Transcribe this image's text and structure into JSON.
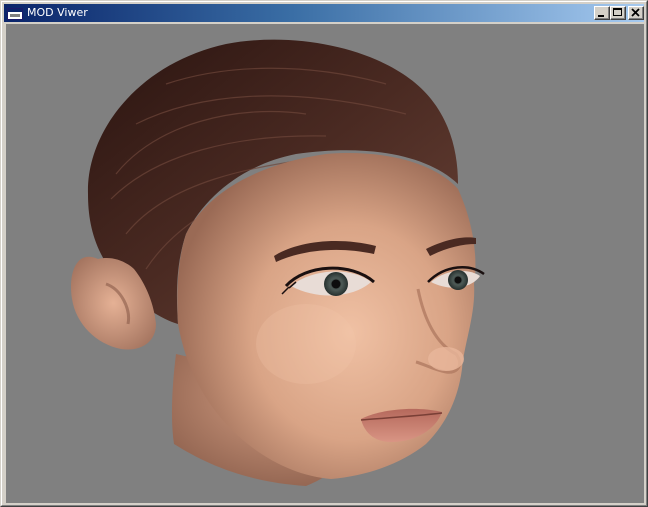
{
  "window": {
    "title": "MOD Viwer",
    "viewport_background": "#808080"
  },
  "titlebar": {
    "app_icon": "app-window-icon",
    "buttons": [
      {
        "name": "minimize",
        "icon": "minimize-icon"
      },
      {
        "name": "maximize",
        "icon": "maximize-icon"
      },
      {
        "name": "close",
        "icon": "close-icon"
      }
    ]
  },
  "viewport": {
    "content": "3d-model-render",
    "model": "human-head",
    "colors": {
      "hair": "#3a1e17",
      "skin": "#d9a486",
      "lips": "#c98472"
    }
  }
}
